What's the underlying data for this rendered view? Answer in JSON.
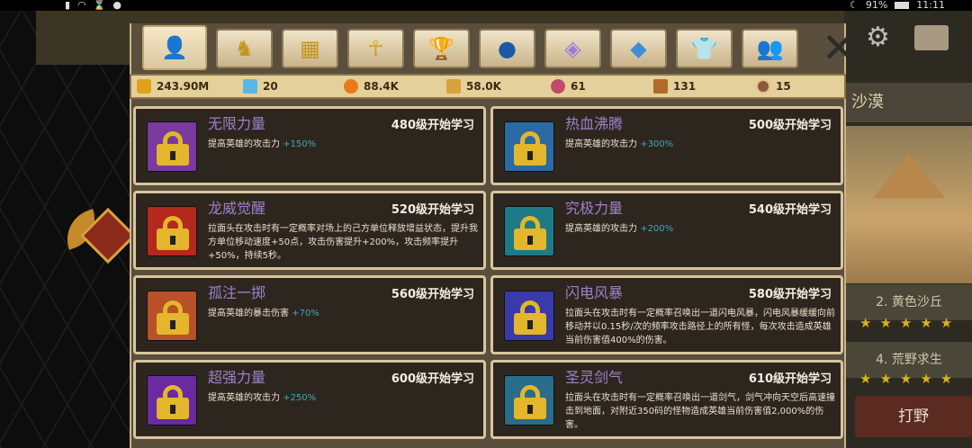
{
  "status_bar": {
    "battery": "91%",
    "time": "11:11"
  },
  "background": {
    "region_title": "沙漠",
    "stage_2": "2. 黄色沙丘",
    "stage_4": "4. 荒野求生",
    "stars": "★★★★★",
    "fight_button": "打野"
  },
  "tabs": [
    {
      "icon": "hero-icon"
    },
    {
      "icon": "dragon-icon"
    },
    {
      "icon": "shop-icon"
    },
    {
      "icon": "ankh-icon"
    },
    {
      "icon": "trophy-icon"
    },
    {
      "icon": "orb-icon"
    },
    {
      "icon": "gem-frame-icon"
    },
    {
      "icon": "crystal-icon"
    },
    {
      "icon": "shirt-icon"
    },
    {
      "icon": "users-icon"
    }
  ],
  "currency": {
    "gold": "243.90M",
    "diamond": "20",
    "orb": "88.4K",
    "star": "58.0K",
    "flower": "61",
    "hammer": "131",
    "token": "15"
  },
  "skills": [
    {
      "name": "无限力量",
      "req": "480级开始学习",
      "desc": "提高英雄的攻击力 ",
      "bonus": "+150%",
      "color": "#7a3a9e"
    },
    {
      "name": "热血沸腾",
      "req": "500级开始学习",
      "desc": "提高英雄的攻击力 ",
      "bonus": "+300%",
      "color": "#2b6aa3"
    },
    {
      "name": "龙威觉醒",
      "req": "520级开始学习",
      "desc": "拉面头在攻击时有一定概率对场上的己方单位释放增益状态，提升我方单位移动速度+50点，攻击伤害提升+200%，攻击频率提升+50%，持续5秒。",
      "bonus": "",
      "color": "#b5281e"
    },
    {
      "name": "究极力量",
      "req": "540级开始学习",
      "desc": "提高英雄的攻击力 ",
      "bonus": "+200%",
      "color": "#1f7a88"
    },
    {
      "name": "孤注一掷",
      "req": "560级开始学习",
      "desc": "提高英雄的暴击伤害 ",
      "bonus": "+70%",
      "color": "#b8502a"
    },
    {
      "name": "闪电风暴",
      "req": "580级开始学习",
      "desc": "拉面头在攻击时有一定概率召唤出一道闪电风暴，闪电风暴缓缓向前移动并以0.15秒/次的频率攻击路径上的所有怪，每次攻击造成英雄当前伤害值400%的伤害。",
      "bonus": "",
      "color": "#3a3aa8"
    },
    {
      "name": "超强力量",
      "req": "600级开始学习",
      "desc": "提高英雄的攻击力 ",
      "bonus": "+250%",
      "color": "#6a2aa0"
    },
    {
      "name": "圣灵剑气",
      "req": "610级开始学习",
      "desc": "拉面头在攻击时有一定概率召唤出一道剑气，剑气冲向天空后高速撞击到地面，对附近350码的怪物造成英雄当前伤害值2,000%的伤害。",
      "bonus": "",
      "color": "#2a6d8a"
    }
  ]
}
